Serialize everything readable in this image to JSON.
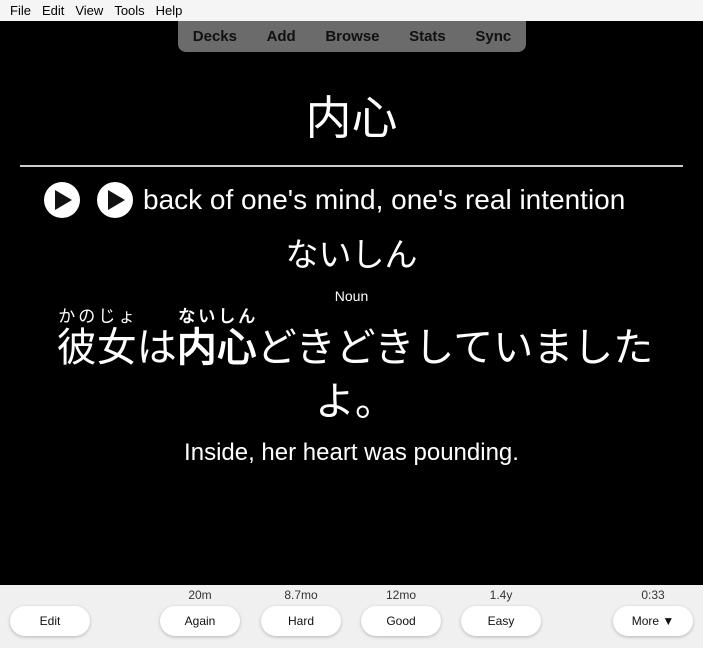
{
  "menu": [
    "File",
    "Edit",
    "View",
    "Tools",
    "Help"
  ],
  "tabs": [
    "Decks",
    "Add",
    "Browse",
    "Stats",
    "Sync"
  ],
  "card": {
    "front": "内心",
    "meaning": "back of one's mind, one's real intention",
    "reading": "ないしん",
    "pos": "Noun",
    "sentence": {
      "w1": "彼女",
      "w1_rt": "かのじょ",
      "p1": "は",
      "w2": "内心",
      "w2_rt": "ないしん",
      "p2": "どきどきしていましたよ。"
    },
    "translation": "Inside, her heart was pounding."
  },
  "bottom": {
    "edit_label": "Edit",
    "again_label": "Again",
    "again_ivl": "20m",
    "hard_label": "Hard",
    "hard_ivl": "8.7mo",
    "good_label": "Good",
    "good_ivl": "12mo",
    "easy_label": "Easy",
    "easy_ivl": "1.4y",
    "more_label": "More ▼",
    "timer": "0:33"
  }
}
